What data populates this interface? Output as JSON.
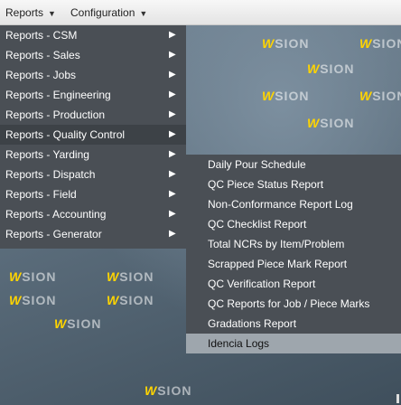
{
  "topbar": {
    "reports_label": "Reports",
    "config_label": "Configuration"
  },
  "watermark": {
    "text": "SION",
    "w_glyph": "W",
    "color": "#ffd400"
  },
  "reports_menu": {
    "items": [
      {
        "label": "Reports - CSM",
        "arrow": "▶"
      },
      {
        "label": "Reports - Sales",
        "arrow": "▶"
      },
      {
        "label": "Reports - Jobs",
        "arrow": "▶"
      },
      {
        "label": "Reports - Engineering",
        "arrow": "▶"
      },
      {
        "label": "Reports - Production",
        "arrow": "▶"
      },
      {
        "label": "Reports - Quality Control",
        "arrow": "▶"
      },
      {
        "label": "Reports - Yarding",
        "arrow": "▶"
      },
      {
        "label": "Reports - Dispatch",
        "arrow": "▶"
      },
      {
        "label": "Reports - Field",
        "arrow": "▶"
      },
      {
        "label": "Reports - Accounting",
        "arrow": "▶"
      },
      {
        "label": "Reports - Generator",
        "arrow": "▶"
      }
    ]
  },
  "qc_submenu": {
    "items": [
      {
        "label": "Daily Pour Schedule"
      },
      {
        "label": "QC Piece Status Report"
      },
      {
        "label": "Non-Conformance Report Log"
      },
      {
        "label": "QC Checklist Report"
      },
      {
        "label": "Total NCRs by Item/Problem"
      },
      {
        "label": "Scrapped Piece Mark Report"
      },
      {
        "label": "QC Verification Report"
      },
      {
        "label": "QC Reports for Job / Piece Marks"
      },
      {
        "label": "Gradations Report"
      },
      {
        "label": "Idencia Logs"
      }
    ]
  }
}
